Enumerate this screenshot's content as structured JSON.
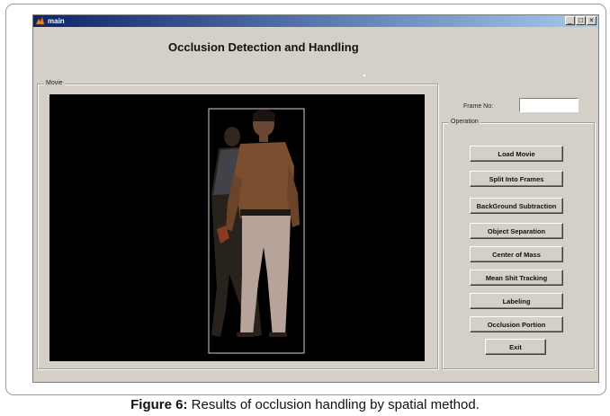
{
  "window": {
    "title": "main",
    "controls": [
      "_",
      "□",
      "×"
    ]
  },
  "heading": "Occlusion Detection and Handling",
  "movie_group": {
    "label": "Movie"
  },
  "frame": {
    "label": "Frame No:",
    "value": ""
  },
  "operation_group": {
    "label": "Operation"
  },
  "buttons": [
    "Load Movie",
    "Split Into Frames",
    "BackGround Subtraction",
    "Object Separation",
    "Center of Mass",
    "Mean Shit Tracking",
    "Labeling",
    "Occlusion Portion",
    "Exit"
  ],
  "caption": {
    "prefix": "Figure 6:",
    "text": " Results of occlusion handling by spatial method."
  }
}
